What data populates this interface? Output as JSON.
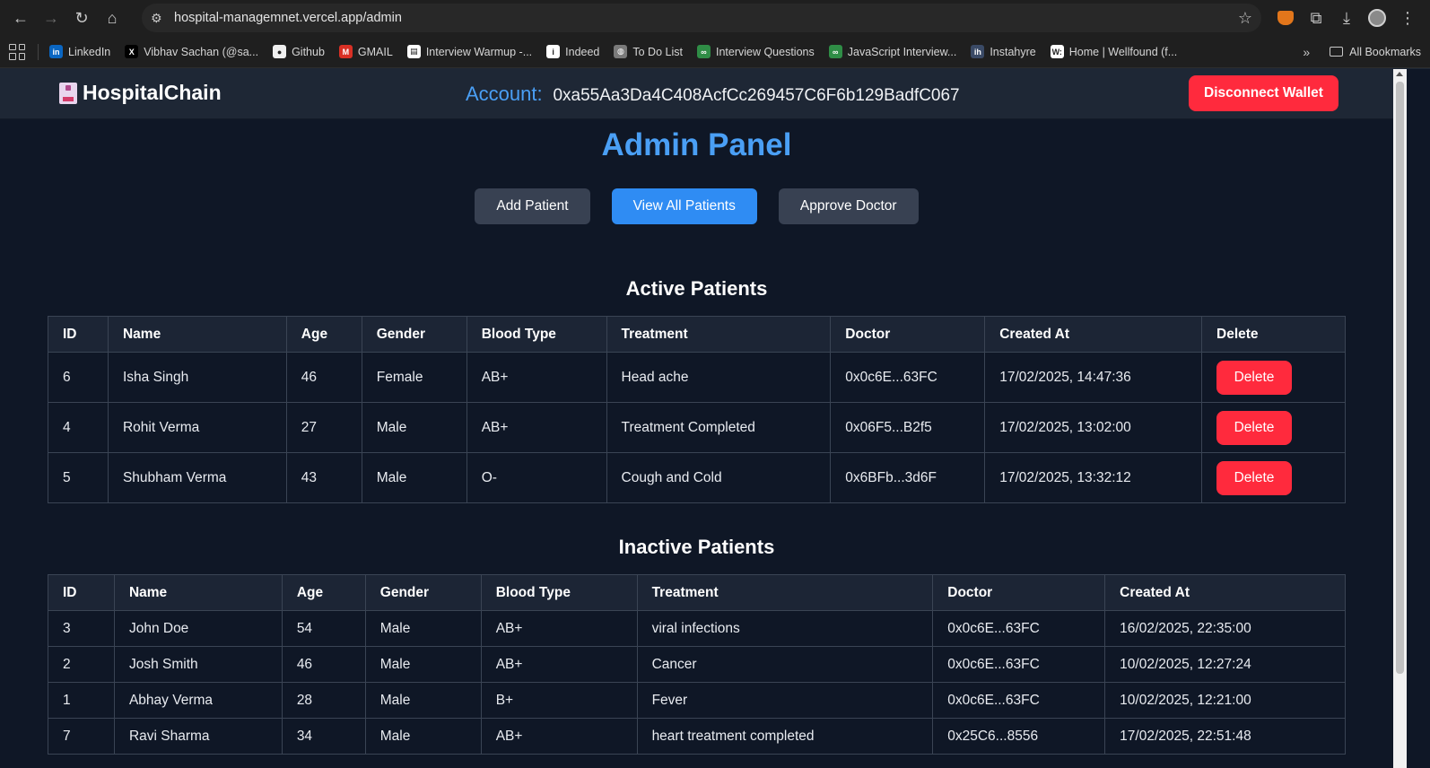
{
  "browser": {
    "url": "hospital-managemnet.vercel.app/admin",
    "bookmarks": [
      {
        "label": "LinkedIn",
        "icon": "linkedin-icon",
        "color": "#0a66c2",
        "glyph": "in"
      },
      {
        "label": "Vibhav Sachan (@sa...",
        "icon": "x-icon",
        "color": "#000000",
        "glyph": "X"
      },
      {
        "label": "Github",
        "icon": "github-icon",
        "color": "#f0f0f0",
        "glyph": "●"
      },
      {
        "label": "GMAIL",
        "icon": "gmail-icon",
        "color": "#d93025",
        "glyph": "M"
      },
      {
        "label": "Interview Warmup -...",
        "icon": "warmup-icon",
        "color": "#ffffff",
        "glyph": "▤"
      },
      {
        "label": "Indeed",
        "icon": "indeed-icon",
        "color": "#ffffff",
        "glyph": "i"
      },
      {
        "label": "To Do List",
        "icon": "globe-icon",
        "color": "#7a7a7a",
        "glyph": "◍"
      },
      {
        "label": "Interview Questions",
        "icon": "gfg-icon",
        "color": "#2f8d46",
        "glyph": "∞"
      },
      {
        "label": "JavaScript Interview...",
        "icon": "gfg-icon",
        "color": "#2f8d46",
        "glyph": "∞"
      },
      {
        "label": "Instahyre",
        "icon": "instahyre-icon",
        "color": "#3a4a66",
        "glyph": "ih"
      },
      {
        "label": "Home | Wellfound (f...",
        "icon": "wellfound-icon",
        "color": "#ffffff",
        "glyph": "W:"
      }
    ],
    "all_bookmarks": "All Bookmarks"
  },
  "header": {
    "brand": "HospitalChain",
    "account_label": "Account:",
    "account_address": "0xa55Aa3Da4C408AcfCc269457C6F6b129BadfC067",
    "disconnect_label": "Disconnect Wallet"
  },
  "main": {
    "title": "Admin Panel",
    "actions": {
      "add_patient": "Add Patient",
      "view_all": "View All Patients",
      "approve_doctor": "Approve Doctor"
    },
    "active": {
      "title": "Active Patients",
      "headers": [
        "ID",
        "Name",
        "Age",
        "Gender",
        "Blood Type",
        "Treatment",
        "Doctor",
        "Created At",
        "Delete"
      ],
      "delete_label": "Delete",
      "rows": [
        [
          "6",
          "Isha Singh",
          "46",
          "Female",
          "AB+",
          "Head ache",
          "0x0c6E...63FC",
          "17/02/2025, 14:47:36"
        ],
        [
          "4",
          "Rohit Verma",
          "27",
          "Male",
          "AB+",
          "Treatment Completed",
          "0x06F5...B2f5",
          "17/02/2025, 13:02:00"
        ],
        [
          "5",
          "Shubham Verma",
          "43",
          "Male",
          "O-",
          "Cough and Cold",
          "0x6BFb...3d6F",
          "17/02/2025, 13:32:12"
        ]
      ]
    },
    "inactive": {
      "title": "Inactive Patients",
      "headers": [
        "ID",
        "Name",
        "Age",
        "Gender",
        "Blood Type",
        "Treatment",
        "Doctor",
        "Created At"
      ],
      "rows": [
        [
          "3",
          "John Doe",
          "54",
          "Male",
          "AB+",
          "viral infections",
          "0x0c6E...63FC",
          "16/02/2025, 22:35:00"
        ],
        [
          "2",
          "Josh Smith",
          "46",
          "Male",
          "AB+",
          "Cancer",
          "0x0c6E...63FC",
          "10/02/2025, 12:27:24"
        ],
        [
          "1",
          "Abhay Verma",
          "28",
          "Male",
          "B+",
          "Fever",
          "0x0c6E...63FC",
          "10/02/2025, 12:21:00"
        ],
        [
          "7",
          "Ravi Sharma",
          "34",
          "Male",
          "AB+",
          "heart treatment completed",
          "0x25C6...8556",
          "17/02/2025, 22:51:48"
        ]
      ]
    }
  },
  "colors": {
    "accent": "#4a9ff5",
    "danger": "#ff2a3d",
    "primary_button": "#2f8cf3",
    "background": "#0f1726"
  }
}
